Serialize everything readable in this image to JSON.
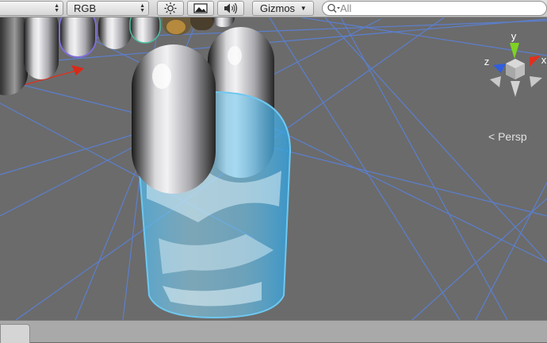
{
  "toolbar": {
    "channel_dropdown": {
      "value": "RGB"
    },
    "lighting_toggle": {
      "icon": "sun-icon"
    },
    "image_toggle": {
      "icon": "image-icon"
    },
    "audio_toggle": {
      "icon": "speaker-icon"
    },
    "gizmos_menu": {
      "label": "Gizmos"
    },
    "search": {
      "placeholder": "All",
      "icon": "search-icon"
    }
  },
  "scene": {
    "projection_label": "Persp",
    "gizmo": {
      "y": "y",
      "x": "x",
      "z": "z"
    },
    "colors": {
      "background": "#6b6b6b",
      "grid": "#5b7fcf",
      "x_axis": "#e0301e",
      "y_axis": "#7ed321",
      "z_axis": "#2f5fe0",
      "selection": "#6ec8f0"
    }
  }
}
